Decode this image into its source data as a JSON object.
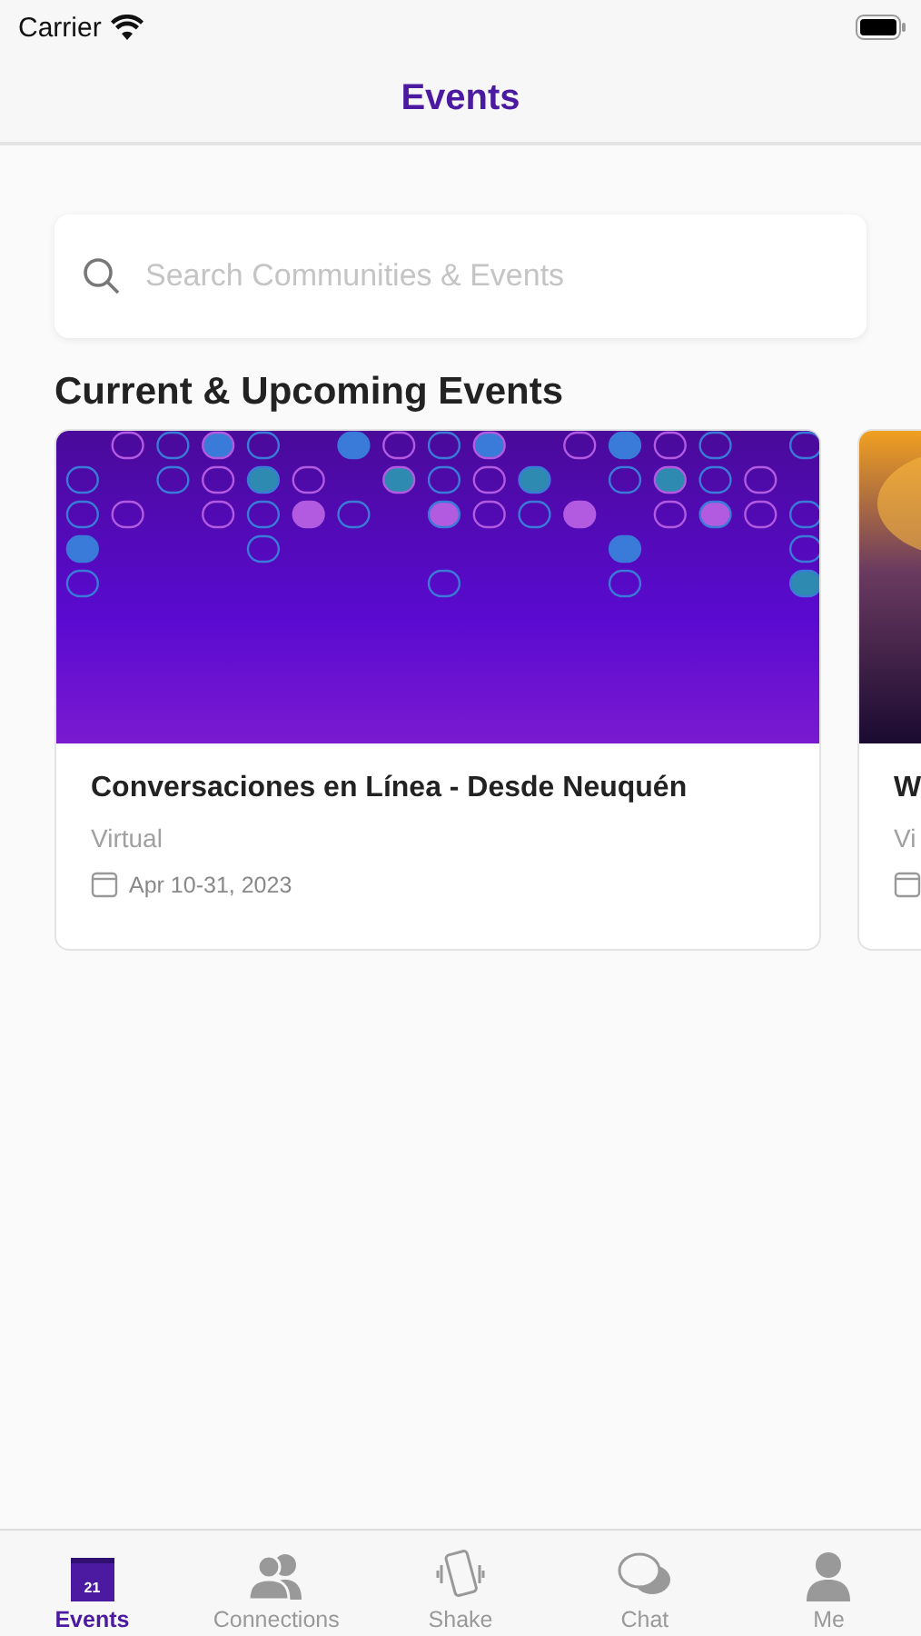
{
  "status_bar": {
    "carrier": "Carrier"
  },
  "nav_bar": {
    "title": "Events"
  },
  "search": {
    "placeholder": "Search Communities & Events"
  },
  "section": {
    "title": "Current & Upcoming Events"
  },
  "events": [
    {
      "kind": "purple",
      "title": "Conversaciones en Línea - Desde Neuquén",
      "location": "Virtual",
      "date": "Apr 10-31, 2023"
    },
    {
      "kind": "sunset",
      "title": "W",
      "location": "Vi"
    }
  ],
  "tab_bar": [
    {
      "kind": "calendar",
      "label": "Events",
      "badge": "21",
      "selected": true
    },
    {
      "kind": "people",
      "label": "Connections",
      "selected": false
    },
    {
      "kind": "phone",
      "label": "Shake",
      "selected": false
    },
    {
      "kind": "chat",
      "label": "Chat",
      "selected": false
    },
    {
      "kind": "person",
      "label": "Me",
      "selected": false
    }
  ]
}
